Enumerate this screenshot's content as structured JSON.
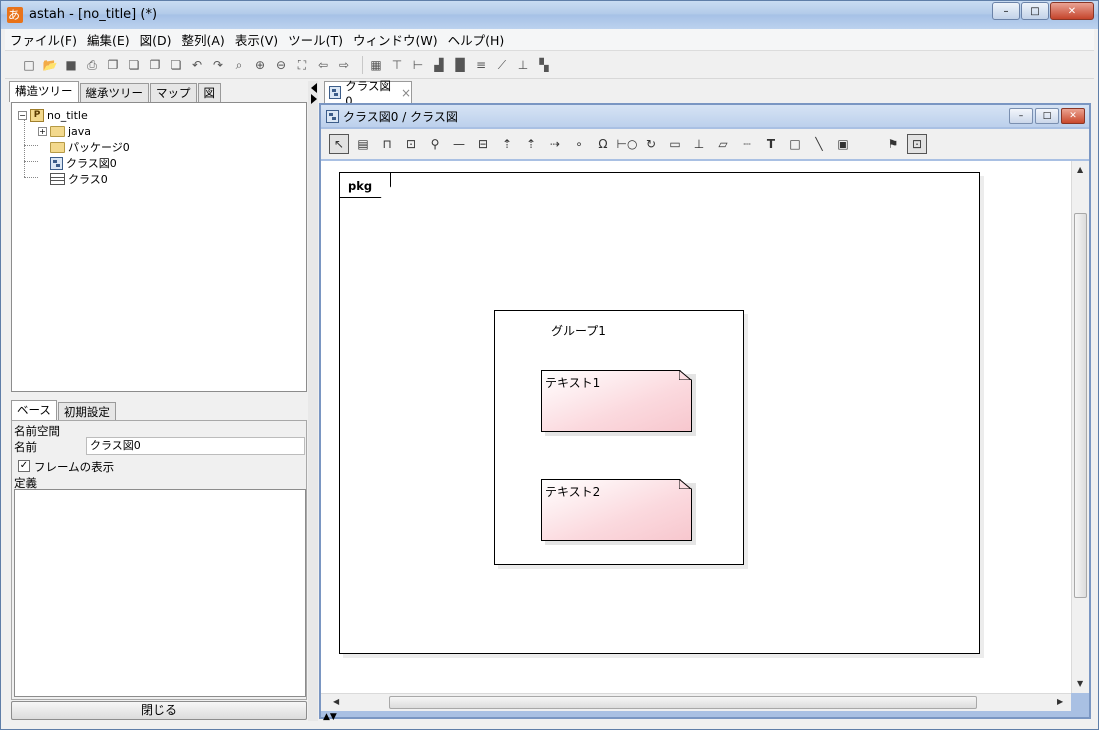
{
  "window": {
    "title": "astah - [no_title] (*)",
    "minimize": "–",
    "maximize": "□",
    "close": "✕"
  },
  "menu": [
    "ファイル(F)",
    "編集(E)",
    "図(D)",
    "整列(A)",
    "表示(V)",
    "ツール(T)",
    "ウィンドウ(W)",
    "ヘルプ(H)"
  ],
  "left_panel": {
    "tabs": [
      "構造ツリー",
      "継承ツリー",
      "マップ",
      "図"
    ],
    "active_tab": "構造ツリー",
    "tree": {
      "root": "no_title",
      "root_toggle": "−",
      "children": [
        {
          "label": "java",
          "icon": "folder-icon",
          "toggle": "+"
        },
        {
          "label": "パッケージ0",
          "icon": "folder-icon"
        },
        {
          "label": "クラス図0",
          "icon": "class-diagram-icon"
        },
        {
          "label": "クラス0",
          "icon": "class-icon"
        }
      ]
    },
    "properties": {
      "tabs": [
        "ベース",
        "初期設定"
      ],
      "active_tab": "ベース",
      "namespace_label": "名前空間",
      "name_label": "名前",
      "name_value": "クラス図0",
      "show_frame_label": "フレームの表示",
      "show_frame_checked": true,
      "definition_label": "定義",
      "close_button": "閉じる"
    }
  },
  "editor": {
    "doc_tab_label": "クラス図0",
    "doc_tab_close": "×",
    "inner_title": "クラス図0 / クラス図",
    "canvas": {
      "frame_label": "pkg",
      "group_label": "グループ1",
      "notes": [
        "テキスト1",
        "テキスト2"
      ]
    }
  },
  "colors": {
    "note_fill": "#fbd9de",
    "frame_border": "#7a96c2",
    "title_bar": "#b3cbe9"
  }
}
